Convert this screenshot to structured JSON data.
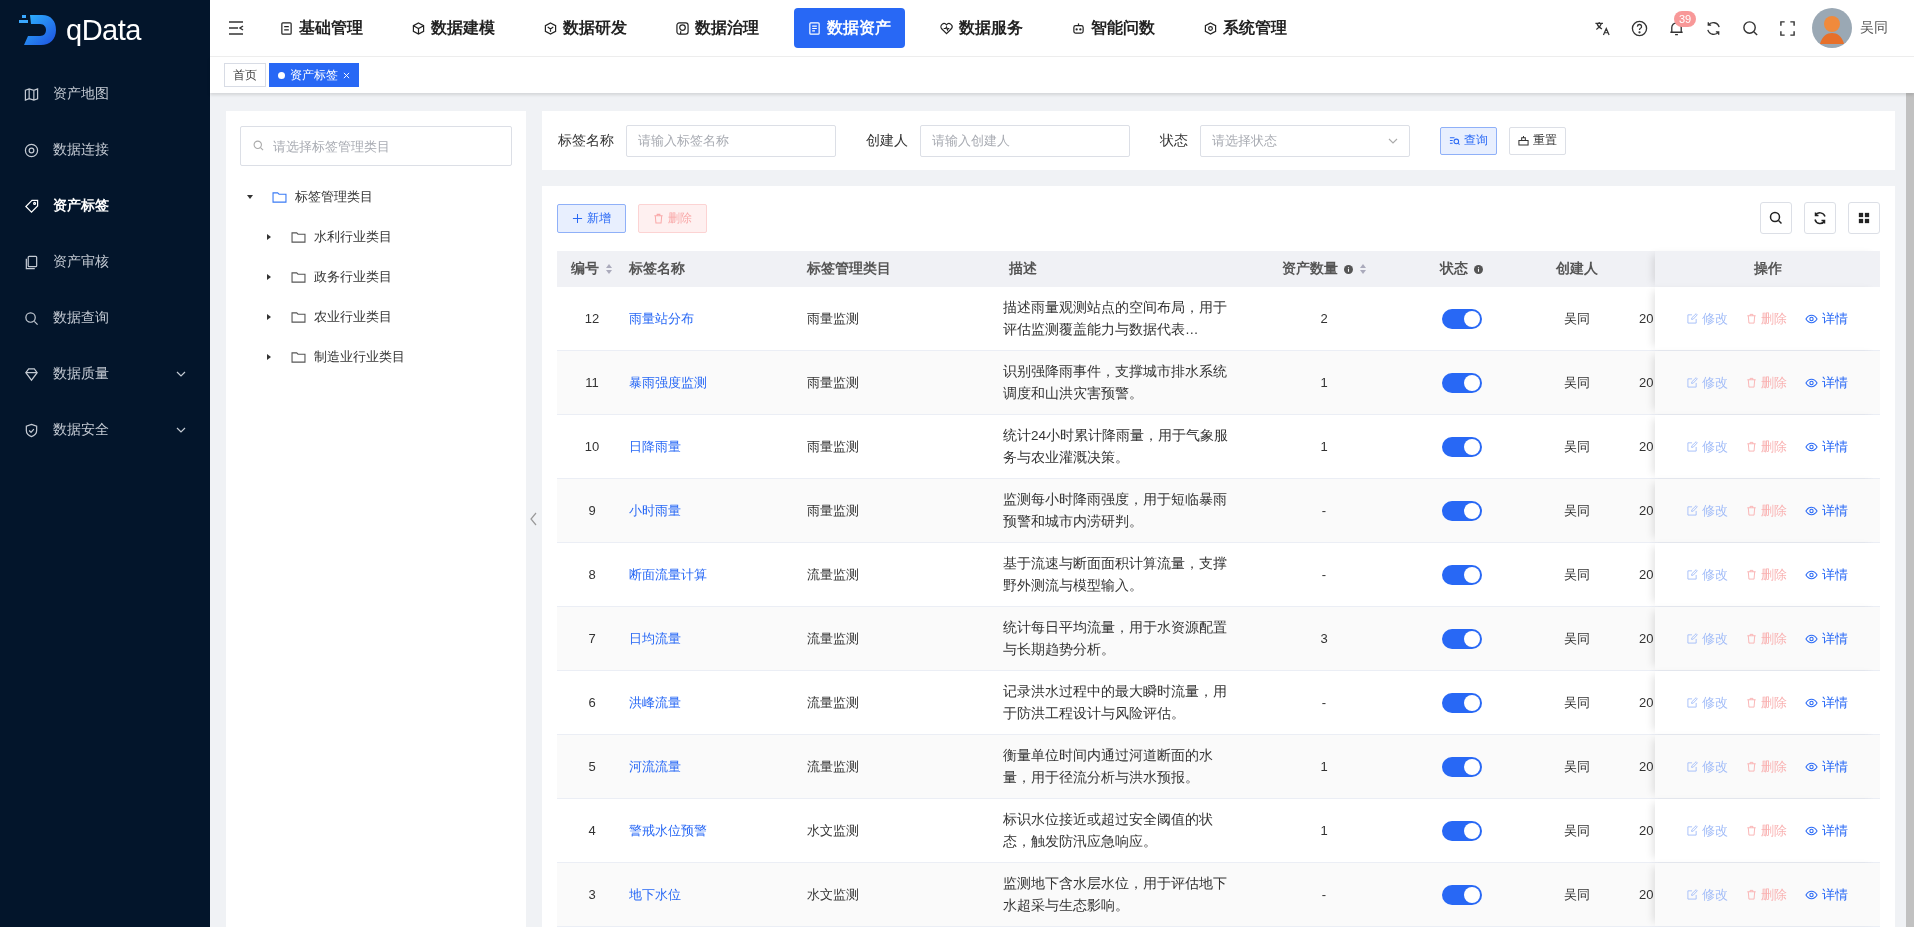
{
  "logo": {
    "text": "qData"
  },
  "sidebar": {
    "items": [
      {
        "label": "资产地图",
        "selected": false,
        "expandable": false
      },
      {
        "label": "数据连接",
        "selected": false,
        "expandable": false
      },
      {
        "label": "资产标签",
        "selected": true,
        "expandable": false
      },
      {
        "label": "资产审核",
        "selected": false,
        "expandable": false
      },
      {
        "label": "数据查询",
        "selected": false,
        "expandable": false
      },
      {
        "label": "数据质量",
        "selected": false,
        "expandable": true
      },
      {
        "label": "数据安全",
        "selected": false,
        "expandable": true
      }
    ]
  },
  "topnav": {
    "items": [
      {
        "label": "基础管理",
        "selected": false
      },
      {
        "label": "数据建模",
        "selected": false
      },
      {
        "label": "数据研发",
        "selected": false
      },
      {
        "label": "数据治理",
        "selected": false
      },
      {
        "label": "数据资产",
        "selected": true
      },
      {
        "label": "数据服务",
        "selected": false
      },
      {
        "label": "智能问数",
        "selected": false
      },
      {
        "label": "系统管理",
        "selected": false
      }
    ]
  },
  "user": {
    "notifications": "39",
    "name": "吴同"
  },
  "tabs": [
    {
      "label": "首页",
      "selected": false,
      "closable": false
    },
    {
      "label": "资产标签",
      "selected": true,
      "closable": true
    }
  ],
  "tree": {
    "placeholder": "请选择标签管理类目",
    "root": {
      "label": "标签管理类目",
      "expanded": true,
      "children": [
        {
          "label": "水利行业类目",
          "expanded": false
        },
        {
          "label": "政务行业类目",
          "expanded": false
        },
        {
          "label": "农业行业类目",
          "expanded": false
        },
        {
          "label": "制造业行业类目",
          "expanded": false
        }
      ]
    }
  },
  "filters": [
    {
      "kind": "input",
      "label": "标签名称",
      "placeholder": "请输入标签名称"
    },
    {
      "kind": "input",
      "label": "创建人",
      "placeholder": "请输入创建人"
    },
    {
      "kind": "select",
      "label": "状态",
      "placeholder": "请选择状态"
    }
  ],
  "filter_buttons": {
    "search": "查询",
    "reset": "重置"
  },
  "toolbar": [
    {
      "kind": "add",
      "label": "新增",
      "disabled": false
    },
    {
      "kind": "delete",
      "label": "删除",
      "disabled": true
    }
  ],
  "table": {
    "columns": [
      {
        "label": "编号",
        "sortable": true,
        "info": false
      },
      {
        "label": "标签名称",
        "sortable": false,
        "info": false
      },
      {
        "label": "标签管理类目",
        "sortable": false,
        "info": false
      },
      {
        "label": "描述",
        "sortable": false,
        "info": false
      },
      {
        "label": "资产数量",
        "sortable": true,
        "info": true
      },
      {
        "label": "状态",
        "sortable": false,
        "info": true
      },
      {
        "label": "创建人",
        "sortable": false,
        "info": false
      },
      {
        "label": "操作",
        "sortable": false,
        "info": false
      }
    ],
    "rows": [
      {
        "id": "12",
        "name": "雨量站分布",
        "category": "雨量监测",
        "description": "描述雨量观测站点的空间布局，用于评估监测覆盖能力与数据代表…",
        "count": "2",
        "on": true,
        "creator": "吴同",
        "column_8": "20",
        "edit": "修改",
        "delete": "删除",
        "detail": "详情"
      },
      {
        "id": "11",
        "name": "暴雨强度监测",
        "category": "雨量监测",
        "description": "识别强降雨事件，支撑城市排水系统调度和山洪灾害预警。",
        "count": "1",
        "on": true,
        "creator": "吴同",
        "column_8": "20",
        "edit": "修改",
        "delete": "删除",
        "detail": "详情"
      },
      {
        "id": "10",
        "name": "日降雨量",
        "category": "雨量监测",
        "description": "统计24小时累计降雨量，用于气象服务与农业灌溉决策。",
        "count": "1",
        "on": true,
        "creator": "吴同",
        "column_8": "20",
        "edit": "修改",
        "delete": "删除",
        "detail": "详情"
      },
      {
        "id": "9",
        "name": "小时雨量",
        "category": "雨量监测",
        "description": "监测每小时降雨强度，用于短临暴雨预警和城市内涝研判。",
        "count": "-",
        "on": true,
        "creator": "吴同",
        "column_8": "20",
        "edit": "修改",
        "delete": "删除",
        "detail": "详情"
      },
      {
        "id": "8",
        "name": "断面流量计算",
        "category": "流量监测",
        "description": "基于流速与断面面积计算流量，支撑野外测流与模型输入。",
        "count": "-",
        "on": true,
        "creator": "吴同",
        "column_8": "20",
        "edit": "修改",
        "delete": "删除",
        "detail": "详情"
      },
      {
        "id": "7",
        "name": "日均流量",
        "category": "流量监测",
        "description": "统计每日平均流量，用于水资源配置与长期趋势分析。",
        "count": "3",
        "on": true,
        "creator": "吴同",
        "column_8": "20",
        "edit": "修改",
        "delete": "删除",
        "detail": "详情"
      },
      {
        "id": "6",
        "name": "洪峰流量",
        "category": "流量监测",
        "description": "记录洪水过程中的最大瞬时流量，用于防洪工程设计与风险评估。",
        "count": "-",
        "on": true,
        "creator": "吴同",
        "column_8": "20",
        "edit": "修改",
        "delete": "删除",
        "detail": "详情"
      },
      {
        "id": "5",
        "name": "河流流量",
        "category": "流量监测",
        "description": "衡量单位时间内通过河道断面的水量，用于径流分析与洪水预报。",
        "count": "1",
        "on": true,
        "creator": "吴同",
        "column_8": "20",
        "edit": "修改",
        "delete": "删除",
        "detail": "详情"
      },
      {
        "id": "4",
        "name": "警戒水位预警",
        "category": "水文监测",
        "description": "标识水位接近或超过安全阈值的状态，触发防汛应急响应。",
        "count": "1",
        "on": true,
        "creator": "吴同",
        "column_8": "20",
        "edit": "修改",
        "delete": "删除",
        "detail": "详情"
      },
      {
        "id": "3",
        "name": "地下水位",
        "category": "水文监测",
        "description": "监测地下含水层水位，用于评估地下水超采与生态影响。",
        "count": "-",
        "on": true,
        "creator": "吴同",
        "column_8": "20",
        "edit": "修改",
        "delete": "删除",
        "detail": "详情"
      }
    ]
  }
}
